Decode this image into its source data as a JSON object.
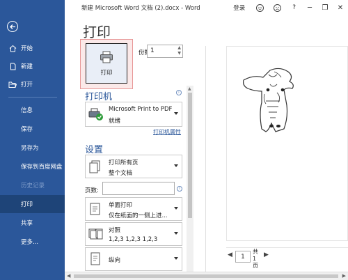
{
  "window": {
    "title": "新建 Microsoft Word 文档 (2).docx - Word",
    "signin": "登录",
    "help": "?",
    "minimize": "─",
    "restore": "❐",
    "close": "✕"
  },
  "sidebar": {
    "top_items": [
      {
        "label": "开始",
        "icon": "home-icon"
      },
      {
        "label": "新建",
        "icon": "new-document-icon"
      },
      {
        "label": "打开",
        "icon": "open-folder-icon"
      }
    ],
    "items": [
      {
        "label": "信息"
      },
      {
        "label": "保存"
      },
      {
        "label": "另存为"
      },
      {
        "label": "保存到百度网盘"
      },
      {
        "label": "历史记录",
        "disabled": true
      },
      {
        "label": "打印",
        "active": true
      },
      {
        "label": "共享"
      },
      {
        "label": "更多..."
      }
    ]
  },
  "print": {
    "page_title": "打印",
    "button_label": "打印",
    "copies_label": "份数:",
    "copies_value": "1",
    "printer_section": "打印机",
    "printer_name": "Microsoft Print to PDF",
    "printer_status": "就绪",
    "printer_properties": "打印机属性",
    "settings_section": "设置",
    "setting_range_l1": "打印所有页",
    "setting_range_l2": "整个文档",
    "pages_label": "页数:",
    "pages_value": "",
    "setting_sides_l1": "单面打印",
    "setting_sides_l2": "仅在纸面的一侧上进...",
    "setting_collate_l1": "对照",
    "setting_collate_l2": "1,2,3    1,2,3    1,2,3",
    "setting_orient_l1": "纵向"
  },
  "preview": {
    "page_value": "1",
    "of_text": "共 1 页"
  },
  "colors": {
    "accent": "#2b579a",
    "highlight": "#e79797"
  }
}
